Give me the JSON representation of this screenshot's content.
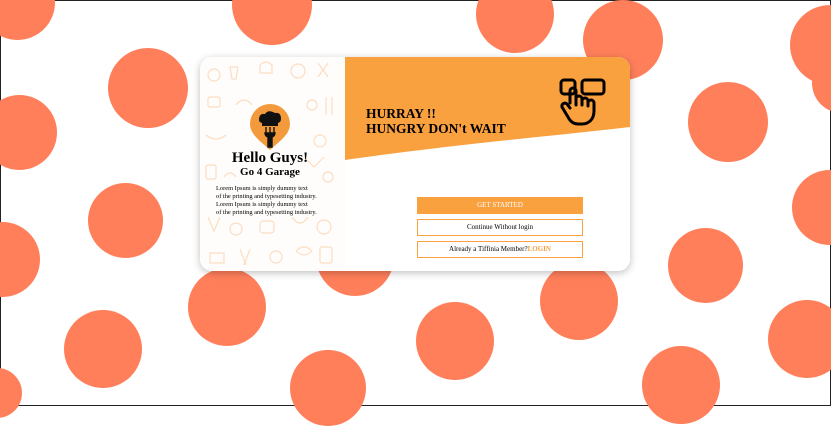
{
  "colors": {
    "accent": "#f9a03f",
    "dots": "#ff7f5a"
  },
  "intro": {
    "greeting": "Hello Guys!",
    "brand": "Go 4 Garage",
    "body_line1": "Lorem Ipsum is simply dummy text",
    "body_line2": "of the printing and typesetting industry.",
    "body_line3": "Lorem Ipsum is simply dummy text",
    "body_line4": "of the printing and typesetting industry."
  },
  "banner": {
    "line1": "HURRAY !!",
    "line2": "HUNGRY DON't WAIT",
    "icon": "touch-hand-icon"
  },
  "actions": {
    "get_started": "GET STARTED",
    "continue": "Continue Without login",
    "member_prompt": "Already a Tiffinia Member?",
    "login": "LOGIN"
  }
}
